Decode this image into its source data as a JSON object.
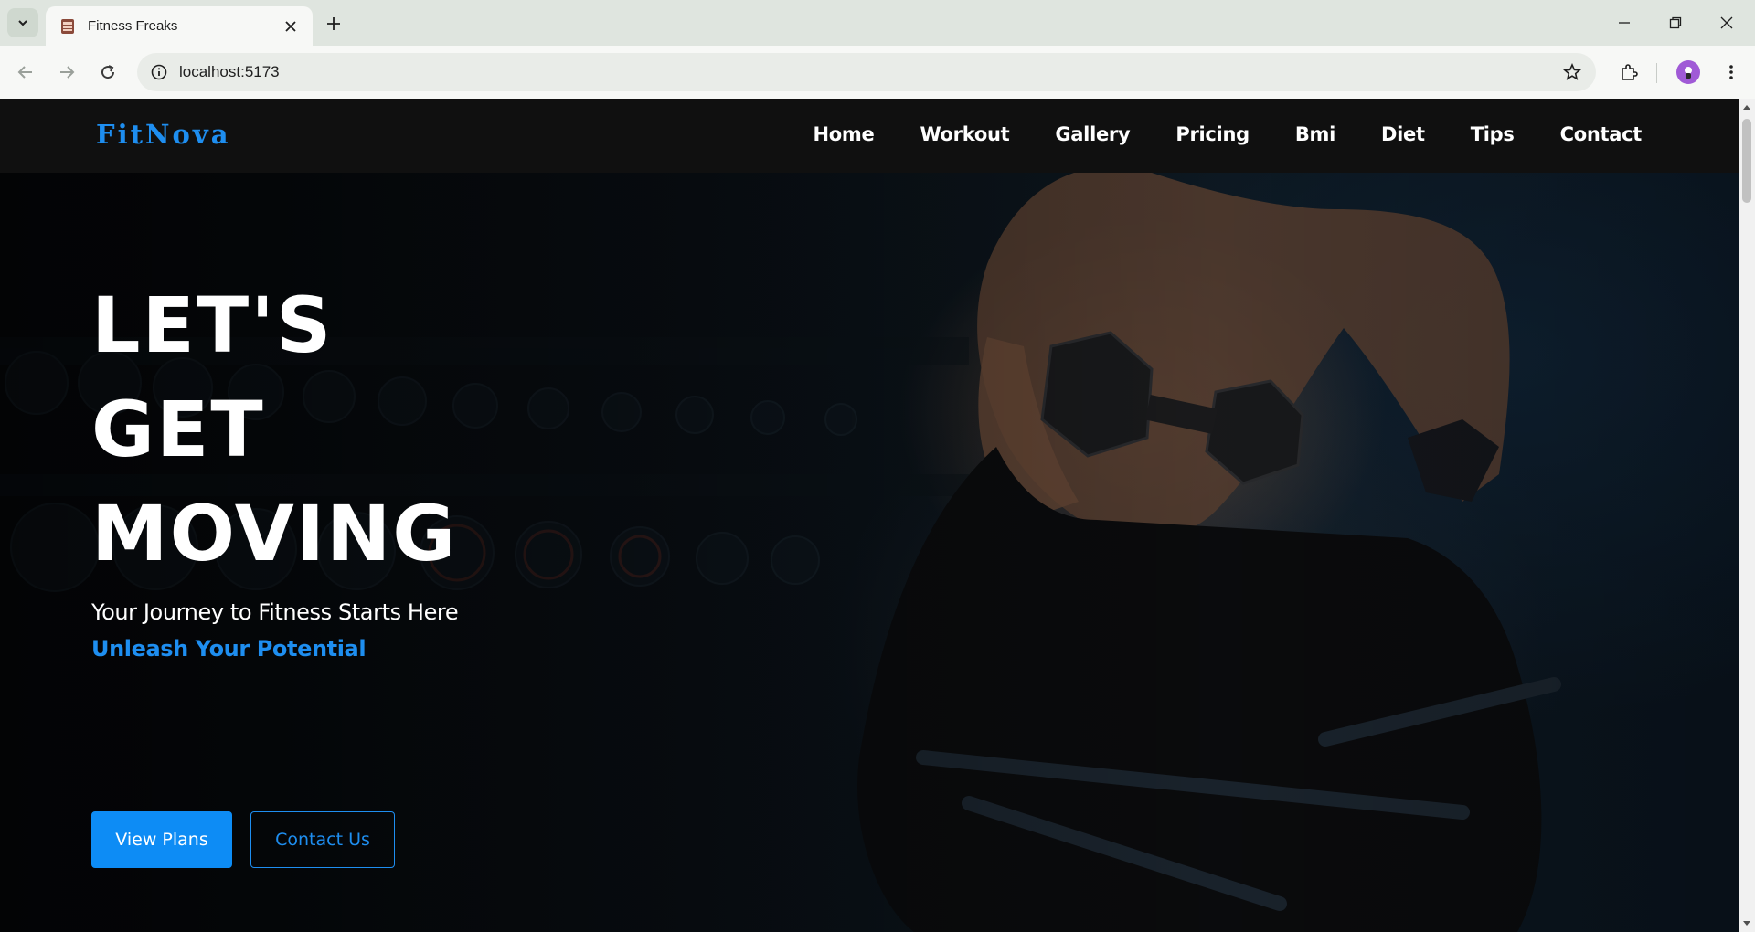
{
  "browser": {
    "tab_title": "Fitness Freaks",
    "url": "localhost:5173",
    "icons": {
      "tab_search": "chevron-down-icon",
      "tab_close": "close-icon",
      "new_tab": "plus-icon",
      "minimize": "minimize-icon",
      "restore": "restore-icon",
      "close_window": "close-icon",
      "back": "arrow-left-icon",
      "forward": "arrow-right-icon",
      "reload": "reload-icon",
      "site_info": "info-icon",
      "bookmark": "star-icon",
      "extensions": "puzzle-icon",
      "menu": "kebab-menu-icon"
    }
  },
  "navbar": {
    "brand": "FitNova",
    "links": [
      "Home",
      "Workout",
      "Gallery",
      "Pricing",
      "Bmi",
      "Diet",
      "Tips",
      "Contact"
    ]
  },
  "hero": {
    "title_lines": [
      "LET'S",
      "GET",
      "MOVING"
    ],
    "subtitle": "Your Journey to Fitness Starts Here",
    "accent": "Unleash Your Potential",
    "primary_button": "View Plans",
    "secondary_button": "Contact Us"
  },
  "colors": {
    "accent": "#1e8ef0",
    "primary_button": "#0d8cf5",
    "navbar_bg": "#101010",
    "chrome_bg": "#dfe5df"
  }
}
